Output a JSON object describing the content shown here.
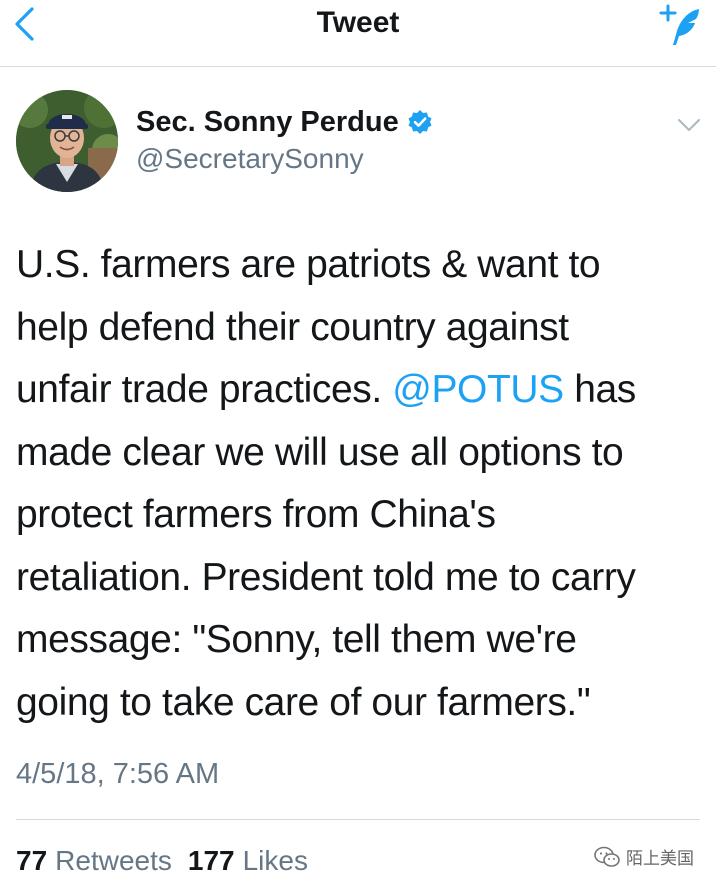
{
  "navbar": {
    "title": "Tweet",
    "back_icon": "chevron-left-icon",
    "compose_icon": "compose-tweet-icon",
    "accent_color": "#1da1f2"
  },
  "author": {
    "display_name": "Sec. Sonny Perdue",
    "handle": "@SecretarySonny",
    "verified": true,
    "avatar_icon": "profile-photo"
  },
  "tweet": {
    "lines": [
      [
        "U.S. farmers are patriots & want to"
      ],
      [
        "help defend their country against"
      ],
      [
        "unfair trade practices. ",
        "@POTUS",
        " has"
      ],
      [
        "made clear we will use all options to"
      ],
      [
        "protect farmers from China's"
      ],
      [
        "retaliation. President told me to carry"
      ],
      [
        "message: \"Sonny, tell them we're"
      ],
      [
        "going to take care of our farmers.\""
      ]
    ],
    "timestamp": "4/5/18, 7:56 AM"
  },
  "stats": {
    "retweets_count": "77",
    "retweets_label": "Retweets",
    "likes_count": "177",
    "likes_label": "Likes"
  },
  "watermark": {
    "text": "陌上美国"
  },
  "colors": {
    "text_primary": "#14171a",
    "text_secondary": "#657786",
    "link": "#1da1f2",
    "divider": "#d7dbdf"
  }
}
